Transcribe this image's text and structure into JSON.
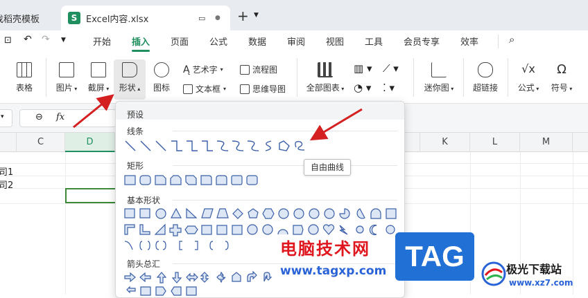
{
  "tabs": {
    "prev": "找稻壳模板",
    "current": "Excel内容.xlsx",
    "add": "+"
  },
  "menu": {
    "items": [
      "开始",
      "插入",
      "页面",
      "公式",
      "数据",
      "审阅",
      "视图",
      "工具",
      "会员专享",
      "效率"
    ],
    "active_index": 1
  },
  "ribbon": {
    "table": "表格",
    "picture": "图片",
    "screenshot": "截屏",
    "shape": "形状",
    "icon": "图标",
    "art_text": "艺术字",
    "text_box": "文本框",
    "flowchart": "流程图",
    "mindmap": "思维导图",
    "all_charts": "全部图表",
    "sparkline": "迷你图",
    "hyperlink": "超链接",
    "formula": "公式",
    "symbol": "符号"
  },
  "formula_bar": {
    "fx": "fx"
  },
  "columns": [
    "C",
    "D",
    "",
    "",
    "",
    "",
    "K",
    "L",
    "M"
  ],
  "cells": {
    "r1": "司1",
    "r2": "司2"
  },
  "shapes_panel": {
    "preset": "预设",
    "lines": "线条",
    "rect": "矩形",
    "basic": "基本形状",
    "arrows": "箭头总汇"
  },
  "tooltip": "自由曲线",
  "watermark": {
    "title": "电脑技术网",
    "url": "www.tagxp.com",
    "tag": "TAG",
    "site_name": "极光下载站",
    "site_url": "www.xz7.com"
  },
  "colors": {
    "accent": "#1f8f5f",
    "arrow": "#d42020"
  }
}
